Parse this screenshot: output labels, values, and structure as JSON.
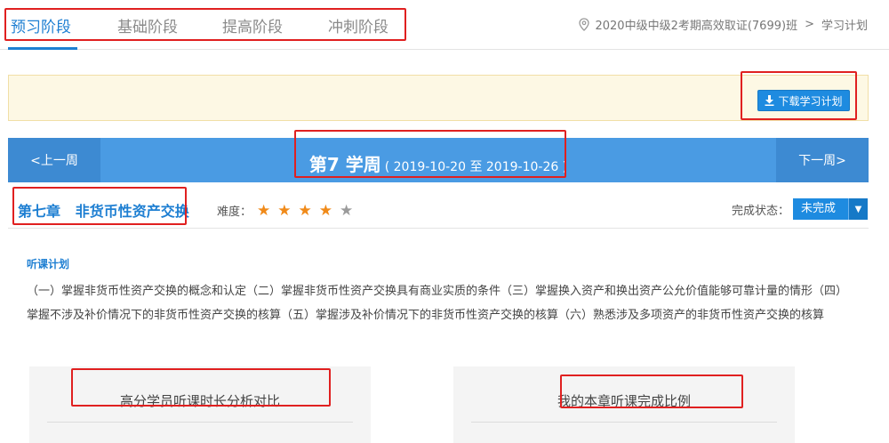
{
  "tabs": [
    "预习阶段",
    "基础阶段",
    "提高阶段",
    "冲刺阶段"
  ],
  "breadcrumb": {
    "class_name": "2020中级中级2考期高效取证(7699)班",
    "separator": ">",
    "current": "学习计划"
  },
  "download_button": "下载学习计划",
  "week": {
    "prev": "<上一周",
    "next": "下一周>",
    "title": "第7 学周",
    "range": "( 2019-10-20 至 2019-10-26 )"
  },
  "chapter": {
    "title": "第七章   非货币性资产交换",
    "difficulty_label": "难度：",
    "difficulty_stars": 4,
    "difficulty_max": 5,
    "status_label": "完成状态：",
    "status_value": "未完成"
  },
  "plan": {
    "title": "听课计划",
    "text": "（一）掌握非货币性资产交换的概念和认定（二）掌握非货币性资产交换具有商业实质的条件（三）掌握换入资产和换出资产公允价值能够可靠计量的情形（四）掌握不涉及补价情况下的非货币性资产交换的核算（五）掌握涉及补价情况下的非货币性资产交换的核算（六）熟悉涉及多项资产的非货币性资产交换的核算"
  },
  "panels": {
    "left_title": "高分学员听课时长分析对比",
    "right_title": "我的本章听课完成比例"
  },
  "colors": {
    "accent": "#1e7fd2",
    "week_bar": "#4a9be3",
    "star": "#f08a19",
    "annotation": "#e02020"
  }
}
